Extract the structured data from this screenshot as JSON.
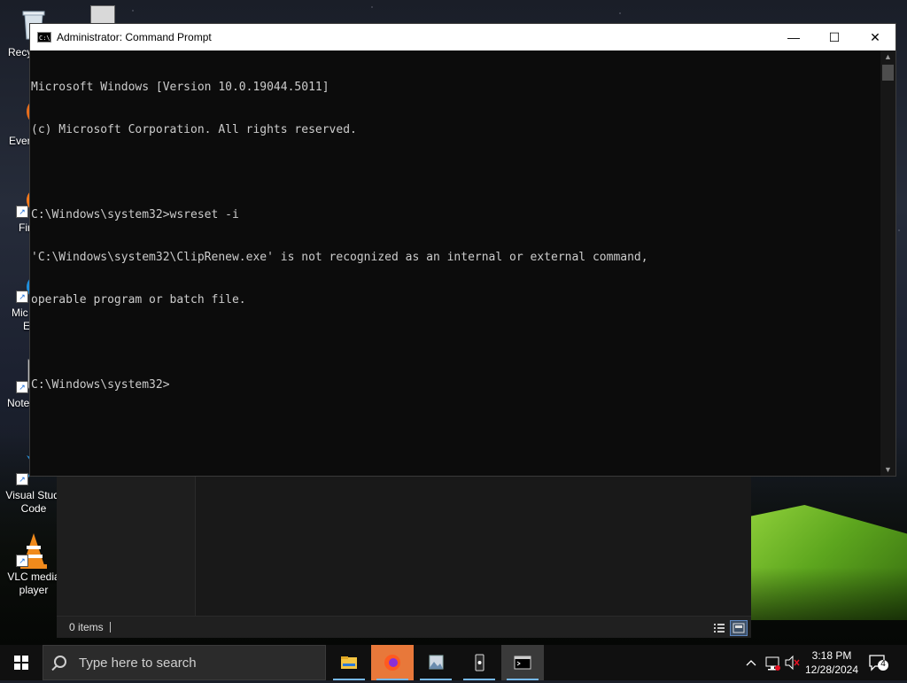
{
  "desktop": {
    "icons": [
      {
        "name": "recycle-bin",
        "label": "Recycle Bin",
        "visible": "Recy"
      },
      {
        "name": "evernote",
        "label": "Evernote",
        "visible": "Ever"
      },
      {
        "name": "firefox",
        "label": "Firefox",
        "visible": "Fir"
      },
      {
        "name": "microsoft-edge",
        "label": "Microsoft Edge",
        "visible_line1": "Mic",
        "visible_line2": "E"
      },
      {
        "name": "notepad-plus-plus",
        "label": "Notepad++",
        "visible": "Note"
      },
      {
        "name": "visual-studio-code",
        "line1": "Visual Studi",
        "line2": "Code"
      },
      {
        "name": "vlc-media-player",
        "line1": "VLC media",
        "line2": "player"
      }
    ]
  },
  "cmd_window": {
    "title": "Administrator: Command Prompt",
    "icon_text": "C:\\",
    "buttons": {
      "minimize": "—",
      "maximize": "☐",
      "close": "✕"
    },
    "lines": [
      "Microsoft Windows [Version 10.0.19044.5011]",
      "(c) Microsoft Corporation. All rights reserved.",
      "",
      "C:\\Windows\\system32>wsreset -i",
      "'C:\\Windows\\system32\\ClipRenew.exe' is not recognized as an internal or external command,",
      "operable program or batch file.",
      "",
      "C:\\Windows\\system32>"
    ],
    "colors": {
      "background": "#0c0c0c",
      "text": "#cccccc"
    }
  },
  "explorer_window": {
    "status_text": "0 items"
  },
  "taskbar": {
    "search_placeholder": "Type here to search",
    "apps": [
      "file-explorer",
      "firefox",
      "photos-viewer",
      "phone-link",
      "command-prompt"
    ],
    "active_app": "command-prompt",
    "clock_time": "3:18 PM",
    "clock_date": "12/28/2024",
    "notification_count": "4",
    "accent": "#76b9ed"
  }
}
